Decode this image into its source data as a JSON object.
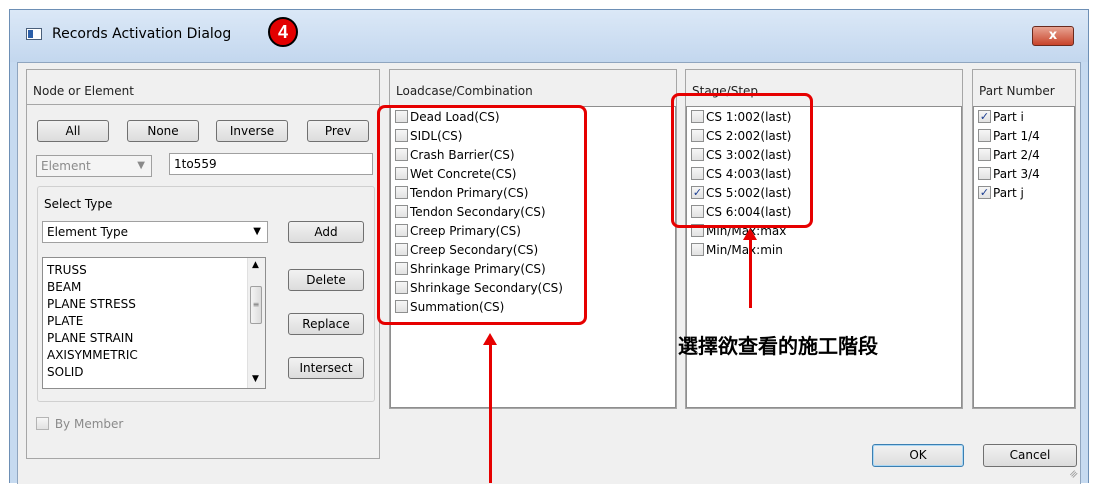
{
  "dialog": {
    "title": "Records Activation Dialog",
    "step_badge": "4",
    "close_symbol": "x"
  },
  "node_panel": {
    "header": "Node or Element",
    "buttons": {
      "all": "All",
      "none": "None",
      "inverse": "Inverse",
      "prev": "Prev"
    },
    "element_combo": "Element",
    "range_value": "1to559",
    "select_type": {
      "label": "Select Type",
      "combo": "Element Type",
      "add": "Add",
      "delete": "Delete",
      "replace": "Replace",
      "intersect": "Intersect",
      "items": [
        "TRUSS",
        "BEAM",
        "PLANE STRESS",
        "PLATE",
        "PLANE STRAIN",
        "AXISYMMETRIC",
        "SOLID"
      ]
    },
    "by_member": "By Member"
  },
  "loadcase_panel": {
    "header": "Loadcase/Combination",
    "items": [
      {
        "label": "Dead Load(CS)",
        "checked": false
      },
      {
        "label": "SIDL(CS)",
        "checked": false
      },
      {
        "label": "Crash Barrier(CS)",
        "checked": false
      },
      {
        "label": "Wet Concrete(CS)",
        "checked": false
      },
      {
        "label": "Tendon Primary(CS)",
        "checked": false
      },
      {
        "label": "Tendon Secondary(CS)",
        "checked": false
      },
      {
        "label": "Creep Primary(CS)",
        "checked": false
      },
      {
        "label": "Creep Secondary(CS)",
        "checked": false
      },
      {
        "label": "Shrinkage Primary(CS)",
        "checked": false
      },
      {
        "label": "Shrinkage Secondary(CS)",
        "checked": false
      },
      {
        "label": "Summation(CS)",
        "checked": false
      }
    ]
  },
  "stage_panel": {
    "header": "Stage/Step",
    "items": [
      {
        "label": "CS 1:002(last)",
        "checked": false
      },
      {
        "label": "CS 2:002(last)",
        "checked": false
      },
      {
        "label": "CS 3:002(last)",
        "checked": false
      },
      {
        "label": "CS 4:003(last)",
        "checked": false
      },
      {
        "label": "CS 5:002(last)",
        "checked": true
      },
      {
        "label": "CS 6:004(last)",
        "checked": false
      },
      {
        "label": "Min/Max:max",
        "checked": false
      },
      {
        "label": "Min/Max:min",
        "checked": false
      }
    ],
    "annotation": "選擇欲查看的施工階段"
  },
  "part_panel": {
    "header": "Part Number",
    "items": [
      {
        "label": "Part  i",
        "checked": true
      },
      {
        "label": "Part 1/4",
        "checked": false
      },
      {
        "label": "Part 2/4",
        "checked": false
      },
      {
        "label": "Part 3/4",
        "checked": false
      },
      {
        "label": "Part  j",
        "checked": true
      }
    ]
  },
  "footer": {
    "ok": "OK",
    "cancel": "Cancel"
  },
  "colors": {
    "highlight": "#e60000",
    "title_bar": "#c6daf0",
    "close_button": "#c8442a"
  }
}
